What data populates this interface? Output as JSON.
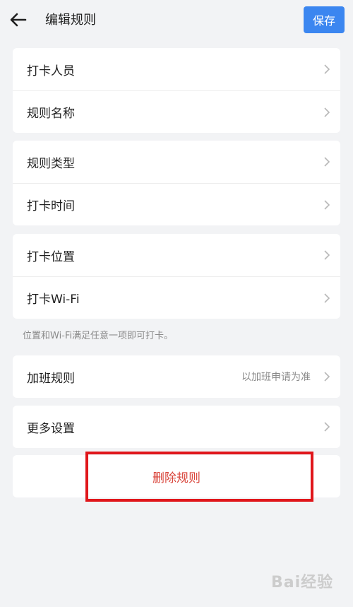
{
  "header": {
    "title": "编辑规则",
    "save_label": "保存"
  },
  "groups": [
    {
      "items": [
        {
          "label": "打卡人员"
        },
        {
          "label": "规则名称"
        }
      ]
    },
    {
      "items": [
        {
          "label": "规则类型"
        },
        {
          "label": "打卡时间"
        }
      ]
    },
    {
      "items": [
        {
          "label": "打卡位置"
        },
        {
          "label": "打卡Wi-Fi"
        }
      ]
    }
  ],
  "hint": "位置和Wi-Fi满足任意一项即可打卡。",
  "overtime": {
    "label": "加班规则",
    "value": "以加班申请为准"
  },
  "more": {
    "label": "更多设置"
  },
  "delete_label": "删除规则",
  "watermark": "Bai经验",
  "colors": {
    "accent": "#3b86f0",
    "danger": "#d9443a",
    "highlight_box": "#e0161b"
  }
}
